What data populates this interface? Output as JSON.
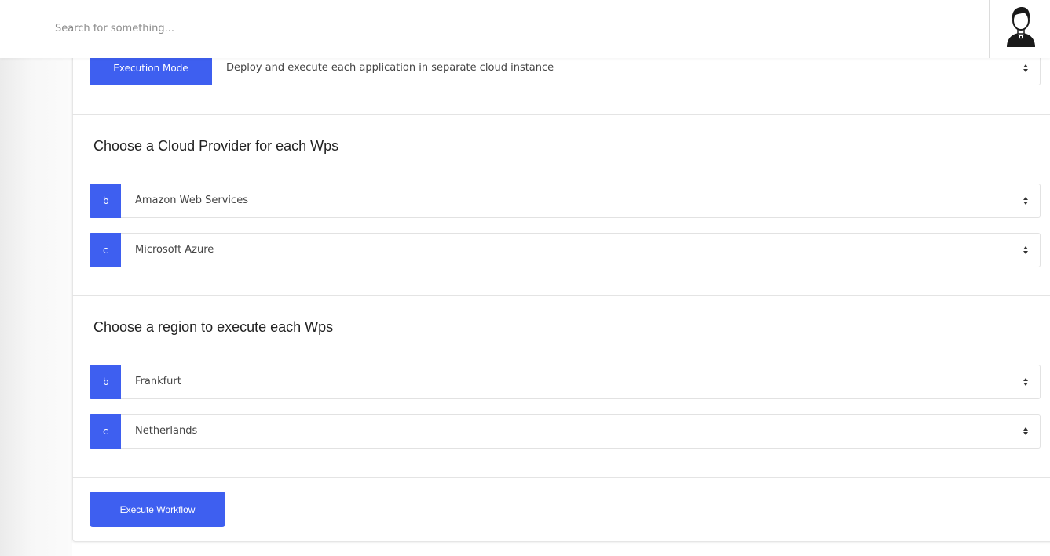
{
  "search": {
    "placeholder": "Search for something..."
  },
  "header": {
    "avatar_icon": "user-avatar-icon"
  },
  "execution_mode": {
    "label": "Execution Mode",
    "value": "Deploy and execute each application in separate cloud instance"
  },
  "cloud_provider": {
    "heading": "Choose a Cloud Provider for each Wps",
    "rows": [
      {
        "tag": "b",
        "value": "Amazon Web Services"
      },
      {
        "tag": "c",
        "value": "Microsoft Azure"
      }
    ]
  },
  "region": {
    "heading": "Choose a region to execute each Wps",
    "rows": [
      {
        "tag": "b",
        "value": "Frankfurt"
      },
      {
        "tag": "c",
        "value": "Netherlands"
      }
    ]
  },
  "actions": {
    "execute_label": "Execute Workflow"
  },
  "colors": {
    "accent": "#3e5ff0"
  }
}
